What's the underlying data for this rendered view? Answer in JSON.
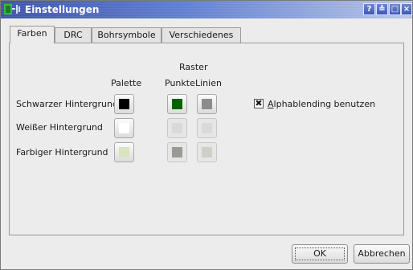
{
  "window": {
    "title": "Einstellungen",
    "titlebar_buttons": [
      "?",
      "≙",
      "□",
      "×"
    ]
  },
  "tabs": [
    {
      "label": "Farben",
      "active": true
    },
    {
      "label": "DRC",
      "active": false
    },
    {
      "label": "Bohrsymbole",
      "active": false
    },
    {
      "label": "Verschiedenes",
      "active": false
    }
  ],
  "colors": {
    "header_raster": "Raster",
    "header_palette": "Palette",
    "header_points": "Punkte",
    "header_lines": "Linien",
    "rows": [
      {
        "label": "Schwarzer Hintergrund",
        "palette": "#000000",
        "points": "#006400",
        "lines": "#8c8c8c",
        "enabled": true
      },
      {
        "label": "Weißer Hintergrund",
        "palette": "#ffffff",
        "points": "#d9d9d9",
        "lines": "#d9d9d9",
        "enabled": false
      },
      {
        "label": "Farbiger Hintergrund",
        "palette": "#d8e5bf",
        "points": "#9a9a93",
        "lines": "#cfcfc7",
        "enabled": false
      }
    ]
  },
  "alpha": {
    "label_first": "A",
    "label_rest": "lphablending benutzen",
    "checked": true
  },
  "buttons": {
    "ok": "OK",
    "cancel": "Abbrechen"
  }
}
